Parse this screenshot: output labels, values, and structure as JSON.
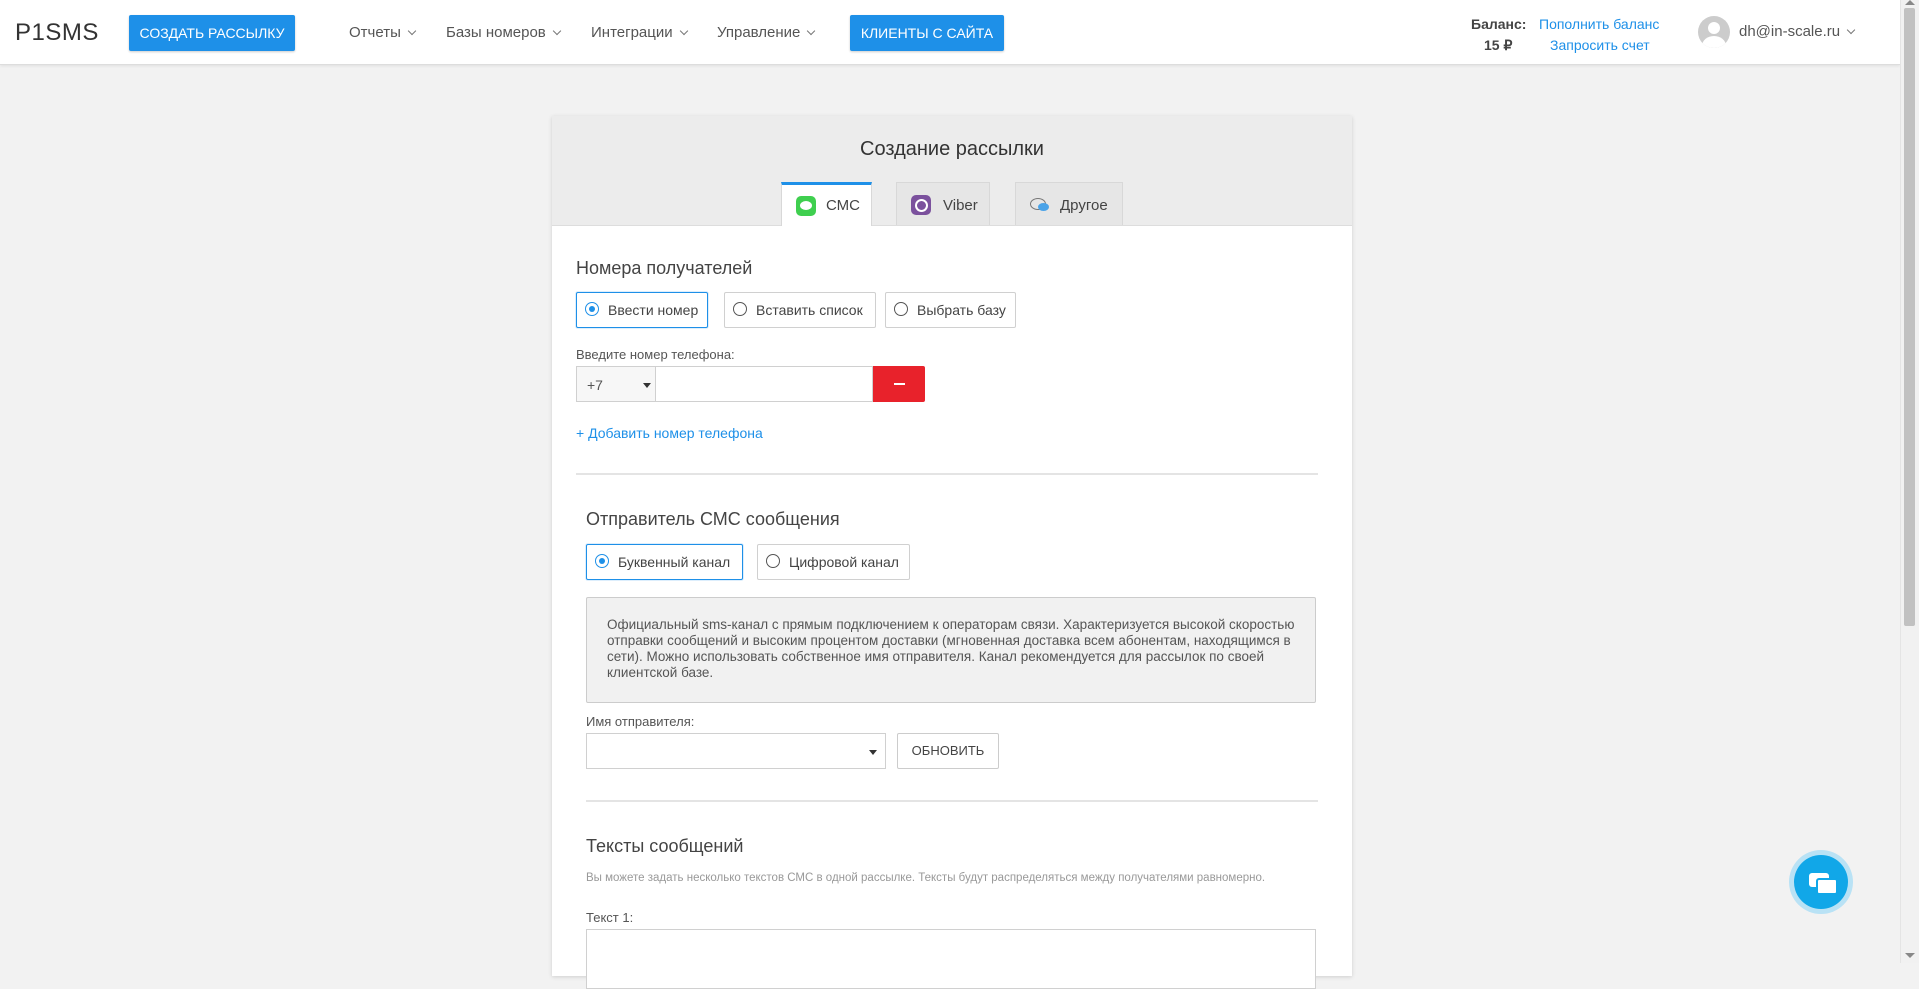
{
  "header": {
    "logo": "P1SMS",
    "create_button": "Создать рассылку",
    "nav": [
      "Отчеты",
      "Базы номеров",
      "Интеграции",
      "Управление"
    ],
    "clients_button": "Клиенты с сайта",
    "balance_label": "Баланс:",
    "balance_value": "15 ₽",
    "topup_link": "Пополнить баланс",
    "invoice_link": "Запросить счет",
    "user_email": "dh@in-scale.ru"
  },
  "card": {
    "title": "Создание рассылки",
    "tabs": [
      "СМС",
      "Viber",
      "Другое"
    ],
    "active_tab": "СМС",
    "recipients": {
      "title": "Номера получателей",
      "options": [
        "Ввести номер",
        "Вставить список",
        "Выбрать базу"
      ],
      "selected": "Ввести номер",
      "phone_label": "Введите номер телефона:",
      "country_code": "+7",
      "phone_value": "",
      "add_link": "+ Добавить номер телефона"
    },
    "sender": {
      "title": "Отправитель СМС сообщения",
      "options": [
        "Буквенный канал",
        "Цифровой канал"
      ],
      "selected": "Буквенный канал",
      "info": "Официальный sms-канал с прямым подключением к операторам связи. Характеризуется высокой скоростью отправки сообщений и высоким процентом доставки (мгновенная доставка всем абонентам, находящимся в сети). Можно использовать собственное имя отправителя. Канал рекомендуется для рассылок по своей клиентской базе.",
      "name_label": "Имя отправителя:",
      "name_value": "",
      "refresh_button": "Обновить"
    },
    "texts": {
      "title": "Тексты сообщений",
      "hint": "Вы можете задать несколько текстов СМС в одной рассылке. Тексты будут распределяться между получателями равномерно.",
      "text1_label": "Текст 1:",
      "text1_value": ""
    }
  },
  "colors": {
    "accent": "#1e90e8",
    "danger": "#e8222b",
    "chat": "#11a7e8"
  }
}
